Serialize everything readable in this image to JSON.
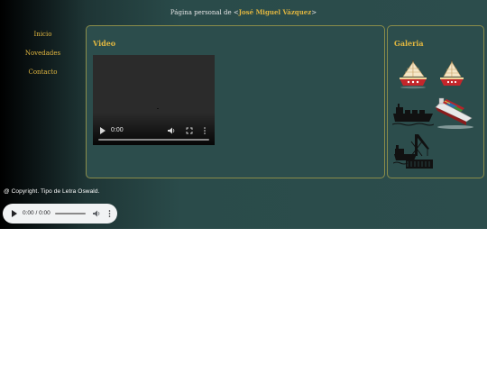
{
  "header": {
    "prefix": "Página personal de <",
    "name": "José Miguel Vázquez",
    "suffix": ">"
  },
  "nav": {
    "items": [
      {
        "label": "Inicio"
      },
      {
        "label": "Novedades"
      },
      {
        "label": "Contacto"
      }
    ]
  },
  "video_section": {
    "title": "Video",
    "player": {
      "time": "0:00"
    }
  },
  "gallery": {
    "title": "Galeria",
    "images": [
      {
        "icon": "sailboat-icon"
      },
      {
        "icon": "sailboat-icon"
      },
      {
        "icon": "tanker-ship-icon"
      },
      {
        "icon": "container-ship-icon"
      },
      {
        "icon": "port-crane-ship-icon"
      }
    ]
  },
  "footer": {
    "text": "@ Copyright. Tipo de Letra Oswald."
  },
  "audio_player": {
    "time": "0:00 / 0:00"
  },
  "colors": {
    "accent": "#e0b640",
    "panel": "#2c4d4c",
    "panel_border": "#8a8c4a",
    "text_light": "#e6e6e6"
  }
}
